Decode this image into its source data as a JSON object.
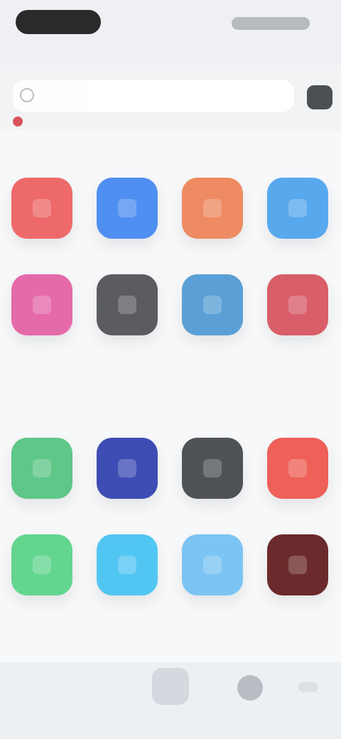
{
  "app": {
    "search": {
      "value": "",
      "placeholder": ""
    }
  },
  "sections": [
    {
      "title": "",
      "apps": [
        {
          "label": "",
          "color": "#ee6a6a",
          "icon": "app-icon"
        },
        {
          "label": "",
          "color": "#4f8ff2",
          "icon": "app-icon"
        },
        {
          "label": "",
          "color": "#ee8b62",
          "icon": "app-icon"
        },
        {
          "label": "",
          "color": "#58a8ee",
          "icon": "app-icon"
        },
        {
          "label": "",
          "color": "#e56aa9",
          "icon": "app-icon"
        },
        {
          "label": "",
          "color": "#5a5c60",
          "icon": "app-icon"
        },
        {
          "label": "",
          "color": "#5aa0d6",
          "icon": "app-icon"
        },
        {
          "label": "",
          "color": "#d85e69",
          "icon": "app-icon"
        }
      ]
    },
    {
      "title": "",
      "apps": [
        {
          "label": "",
          "color": "#5fc788",
          "icon": "app-icon"
        },
        {
          "label": "",
          "color": "#3e4db4",
          "icon": "app-icon"
        },
        {
          "label": "",
          "color": "#4f5256",
          "icon": "app-icon"
        },
        {
          "label": "",
          "color": "#ee6058",
          "icon": "app-icon"
        },
        {
          "label": "",
          "color": "#63d58f",
          "icon": "app-icon"
        },
        {
          "label": "",
          "color": "#52c6f2",
          "icon": "app-icon"
        },
        {
          "label": "",
          "color": "#7cc4f4",
          "icon": "app-icon"
        },
        {
          "label": "",
          "color": "#6b2a2b",
          "icon": "app-icon"
        }
      ]
    }
  ]
}
